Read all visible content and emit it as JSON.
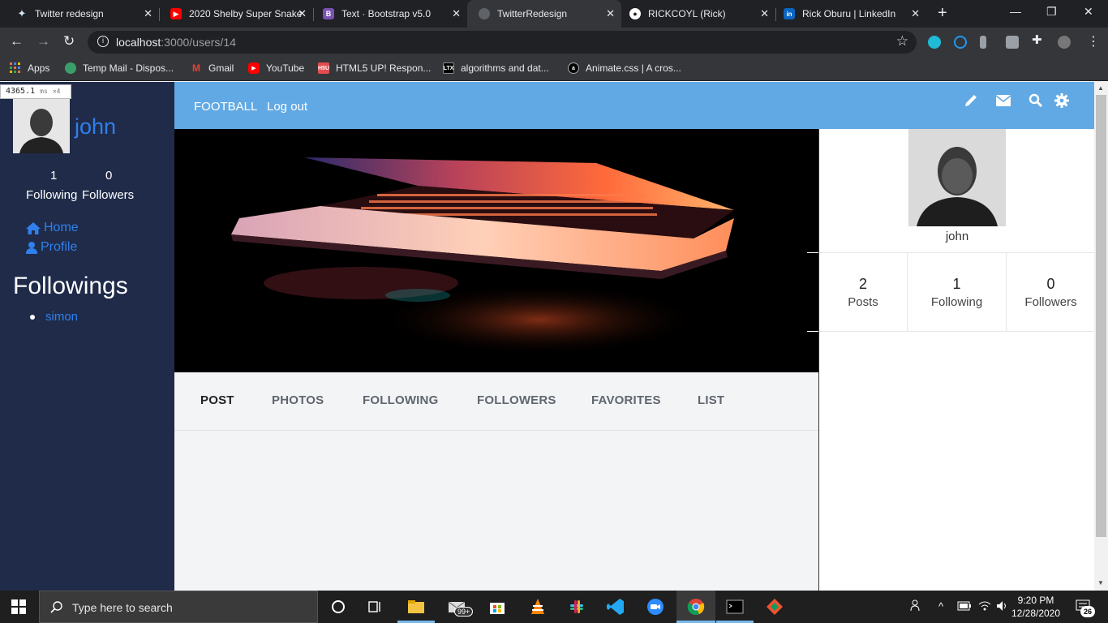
{
  "browser": {
    "tabs": [
      {
        "title": "Twitter redesign",
        "favicon_color": "#cfe6f5"
      },
      {
        "title": "2020 Shelby Super Snake",
        "favicon_color": "#ff0000"
      },
      {
        "title": "Text · Bootstrap v5.0",
        "favicon_color": "#7952b3"
      },
      {
        "title": "TwitterRedesign",
        "favicon_color": "#9aa0a6"
      },
      {
        "title": "RICKCOYL (Rick)",
        "favicon_color": "#ffffff"
      },
      {
        "title": "Rick Oburu | LinkedIn",
        "favicon_color": "#0a66c2"
      }
    ],
    "url_host": "localhost",
    "url_rest": ":3000/users/14",
    "bookmarks": [
      {
        "label": "Apps"
      },
      {
        "label": "Temp Mail - Dispos..."
      },
      {
        "label": "Gmail"
      },
      {
        "label": "YouTube"
      },
      {
        "label": "HTML5 UP! Respon..."
      },
      {
        "label": "algorithms and dat..."
      },
      {
        "label": "Animate.css | A cros..."
      }
    ]
  },
  "perf_overlay": {
    "value": "4365.1",
    "unit": "ms",
    "mult": "×4"
  },
  "sidebar": {
    "username": "john",
    "stats": [
      {
        "count": "1",
        "label": "Following"
      },
      {
        "count": "0",
        "label": "Followers"
      }
    ],
    "nav": [
      {
        "label": "Home",
        "icon": "home-icon"
      },
      {
        "label": "Profile",
        "icon": "user-icon"
      }
    ],
    "followings_title": "Followings",
    "followings": [
      "simon"
    ]
  },
  "topnav": {
    "links": [
      "FOOTBALL",
      "Log out"
    ],
    "icons": [
      "pencil-icon",
      "envelope-icon",
      "search-icon",
      "gear-icon"
    ]
  },
  "profile_tabs": [
    {
      "label": "POST",
      "active": true
    },
    {
      "label": "PHOTOS",
      "active": false
    },
    {
      "label": "FOLLOWING",
      "active": false
    },
    {
      "label": "FOLLOWERS",
      "active": false
    },
    {
      "label": "FAVORITES",
      "active": false
    },
    {
      "label": "LIST",
      "active": false
    }
  ],
  "right_panel": {
    "name": "john",
    "stats": [
      {
        "count": "2",
        "label": "Posts"
      },
      {
        "count": "1",
        "label": "Following"
      },
      {
        "count": "0",
        "label": "Followers"
      }
    ]
  },
  "taskbar": {
    "search_placeholder": "Type here to search",
    "badge": "99+",
    "time": "9:20 PM",
    "date": "12/28/2020",
    "notification_count": "26"
  },
  "colors": {
    "sidebar_bg": "#1f2b49",
    "topnav_bg": "#61a9e4",
    "link_blue": "#2f80ed"
  }
}
